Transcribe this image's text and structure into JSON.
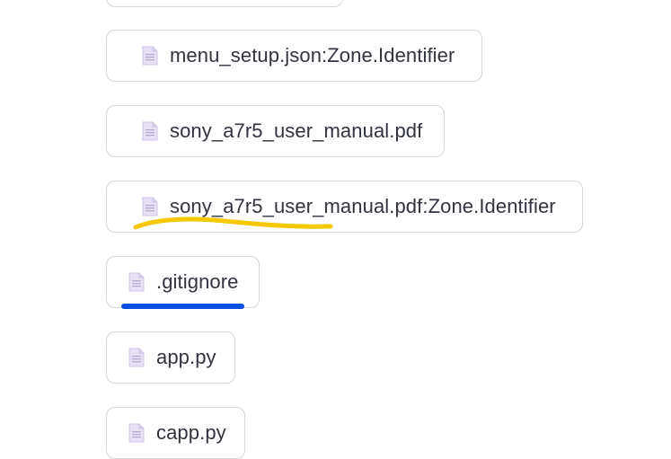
{
  "files": [
    {
      "name": "",
      "icon": "file-icon"
    },
    {
      "name": "menu_setup.json:Zone.Identifier",
      "icon": "file-icon"
    },
    {
      "name": "sony_a7r5_user_manual.pdf",
      "icon": "file-icon"
    },
    {
      "name": "sony_a7r5_user_manual.pdf:Zone.Identifier",
      "icon": "file-icon"
    },
    {
      "name": ".gitignore",
      "icon": "file-icon"
    },
    {
      "name": "app.py",
      "icon": "file-icon"
    },
    {
      "name": "capp.py",
      "icon": "file-icon"
    }
  ],
  "annotations": {
    "yellow_underline_color": "#f5c800",
    "blue_underline_color": "#0a4fe0"
  },
  "colors": {
    "chip_border": "#d5d5dc",
    "text": "#31333f",
    "icon_fill": "#e8e0f4",
    "icon_lines": "#b9a9d6"
  }
}
